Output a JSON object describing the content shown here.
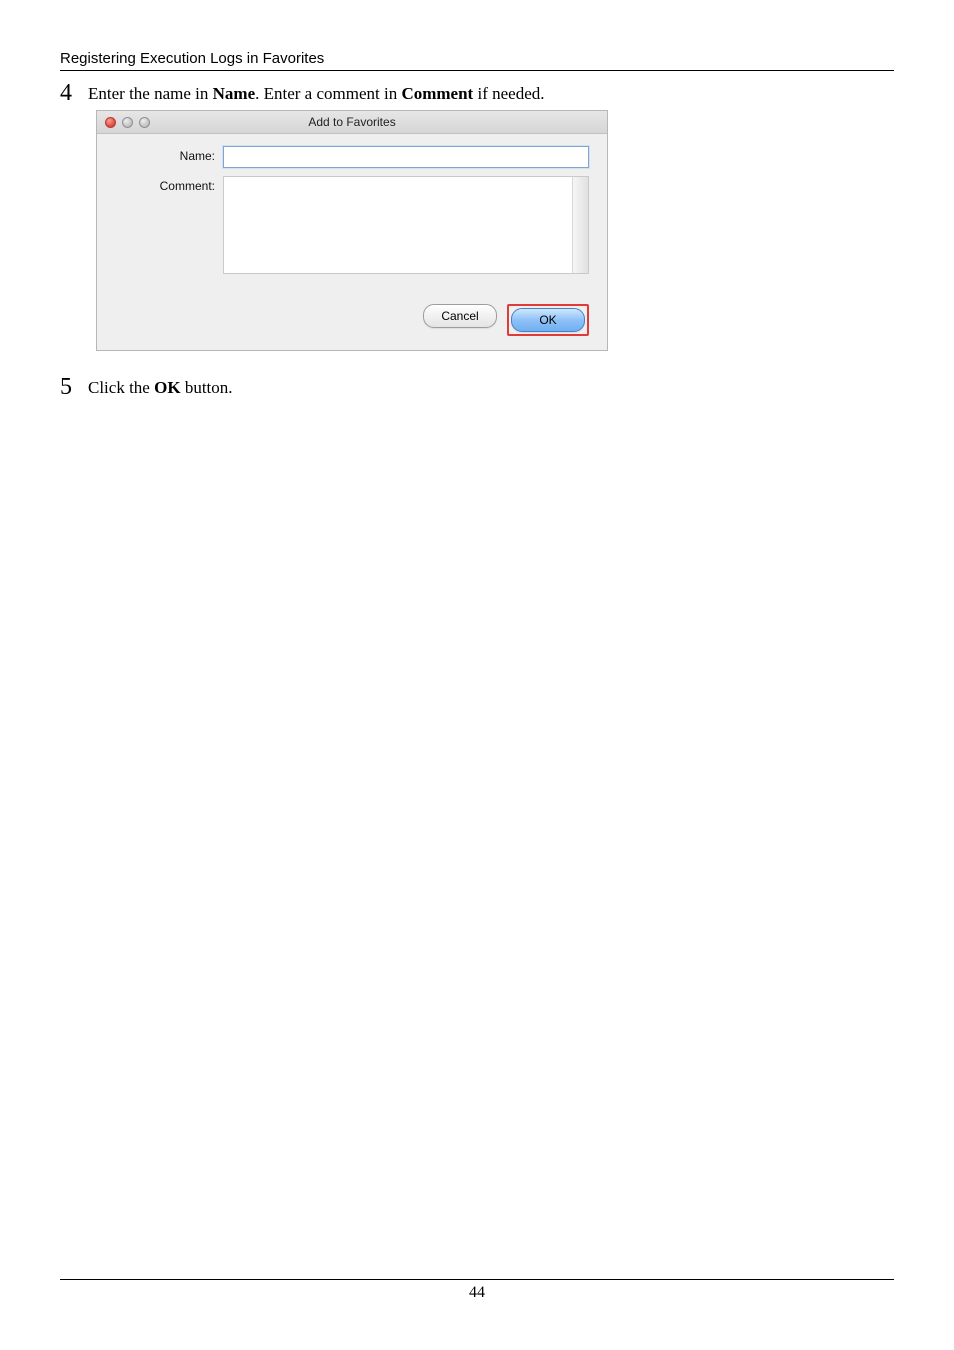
{
  "header": {
    "title": "Registering Execution Logs in Favorites"
  },
  "steps": {
    "s4": {
      "num": "4",
      "text_prefix": "Enter the name in ",
      "b1": "Name",
      "text_mid": ". Enter a comment in ",
      "b2": "Comment",
      "text_suffix": " if needed."
    },
    "s5": {
      "num": "5",
      "text_prefix": "Click the ",
      "b1": "OK",
      "text_suffix": " button."
    }
  },
  "dialog": {
    "title": "Add to Favorites",
    "name_label": "Name:",
    "comment_label": "Comment:",
    "cancel": "Cancel",
    "ok": "OK"
  },
  "footer": {
    "page_number": "44"
  }
}
